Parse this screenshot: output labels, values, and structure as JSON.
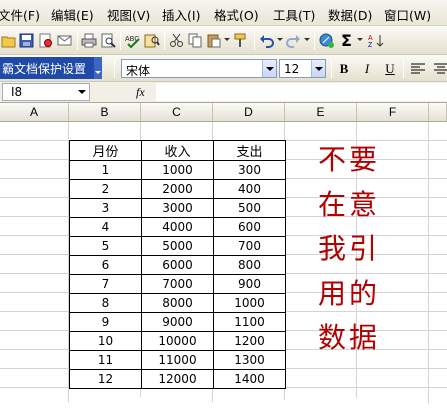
{
  "menu": {
    "items": [
      {
        "label": "文件(F)"
      },
      {
        "label": "编辑(E)"
      },
      {
        "label": "视图(V)"
      },
      {
        "label": "插入(I)"
      },
      {
        "label": "格式(O)"
      },
      {
        "label": "工具(T)"
      },
      {
        "label": "数据(D)"
      },
      {
        "label": "窗口(W)"
      }
    ]
  },
  "toolbar": {
    "protect_label": "霸文档保护设置",
    "font_name": "宋体",
    "font_size": "12",
    "bold_label": "B",
    "italic_label": "I",
    "underline_label": "U",
    "sigma_label": "Σ"
  },
  "formula_bar": {
    "name_box": "I8",
    "fx_label": "fx",
    "formula": ""
  },
  "columns": [
    "A",
    "B",
    "C",
    "D",
    "E",
    "F"
  ],
  "table": {
    "headers": [
      "月份",
      "收入",
      "支出"
    ],
    "rows": [
      [
        "1",
        "1000",
        "300"
      ],
      [
        "2",
        "2000",
        "400"
      ],
      [
        "3",
        "3000",
        "500"
      ],
      [
        "4",
        "4000",
        "600"
      ],
      [
        "5",
        "5000",
        "700"
      ],
      [
        "6",
        "6000",
        "800"
      ],
      [
        "7",
        "7000",
        "900"
      ],
      [
        "8",
        "8000",
        "1000"
      ],
      [
        "9",
        "9000",
        "1100"
      ],
      [
        "10",
        "10000",
        "1200"
      ],
      [
        "11",
        "11000",
        "1300"
      ],
      [
        "12",
        "12000",
        "1400"
      ]
    ]
  },
  "watermark": {
    "lines": [
      "不要",
      "在意",
      "我引",
      "用的",
      "数据"
    ],
    "color": "#b20000"
  },
  "colors": {
    "menubar": "#ece9d8",
    "protect_button": "#1f4aa8",
    "grid_line": "#d4d4d4"
  }
}
